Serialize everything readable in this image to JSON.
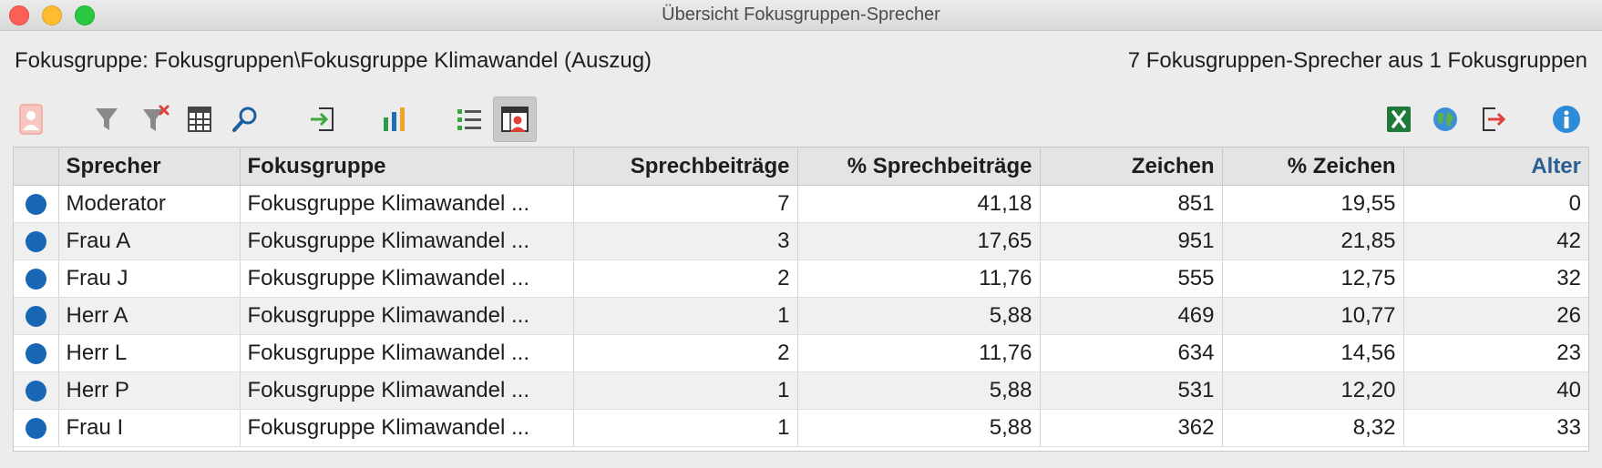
{
  "window": {
    "title": "Übersicht Fokusgruppen-Sprecher"
  },
  "info": {
    "group_label": "Fokusgruppe: Fokusgruppen\\Fokusgruppe Klimawandel (Auszug)",
    "summary": "7 Fokusgruppen-Sprecher aus 1 Fokusgruppen"
  },
  "toolbar": {
    "left_icons": [
      "speaker-card-icon",
      "filter-icon",
      "clear-filter-icon",
      "table-columns-icon",
      "search-icon",
      "export-selection-icon",
      "bar-chart-icon",
      "list-view-icon",
      "speaker-view-icon"
    ],
    "right_icons": [
      "excel-export-icon",
      "html-export-icon",
      "exit-export-icon",
      "info-icon"
    ],
    "active_icon": "speaker-view-icon"
  },
  "colors": {
    "dot": "#1767b4",
    "sorted_header": "#2b5f93",
    "excel_green": "#1f7a3a",
    "info_blue": "#2d8bd8"
  },
  "table": {
    "columns": [
      "",
      "Sprecher",
      "Fokusgruppe",
      "Sprechbeiträge",
      "% Sprechbeiträge",
      "Zeichen",
      "% Zeichen",
      "Alter"
    ],
    "sorted_column": "Alter",
    "rows": [
      {
        "sprecher": "Moderator",
        "fokusgruppe": "Fokusgruppe Klimawandel ...",
        "beitraege": "7",
        "pct_beitraege": "41,18",
        "zeichen": "851",
        "pct_zeichen": "19,55",
        "alter": "0"
      },
      {
        "sprecher": "Frau A",
        "fokusgruppe": "Fokusgruppe Klimawandel ...",
        "beitraege": "3",
        "pct_beitraege": "17,65",
        "zeichen": "951",
        "pct_zeichen": "21,85",
        "alter": "42"
      },
      {
        "sprecher": "Frau J",
        "fokusgruppe": "Fokusgruppe Klimawandel ...",
        "beitraege": "2",
        "pct_beitraege": "11,76",
        "zeichen": "555",
        "pct_zeichen": "12,75",
        "alter": "32"
      },
      {
        "sprecher": "Herr A",
        "fokusgruppe": "Fokusgruppe Klimawandel ...",
        "beitraege": "1",
        "pct_beitraege": "5,88",
        "zeichen": "469",
        "pct_zeichen": "10,77",
        "alter": "26"
      },
      {
        "sprecher": "Herr L",
        "fokusgruppe": "Fokusgruppe Klimawandel ...",
        "beitraege": "2",
        "pct_beitraege": "11,76",
        "zeichen": "634",
        "pct_zeichen": "14,56",
        "alter": "23"
      },
      {
        "sprecher": "Herr P",
        "fokusgruppe": "Fokusgruppe Klimawandel ...",
        "beitraege": "1",
        "pct_beitraege": "5,88",
        "zeichen": "531",
        "pct_zeichen": "12,20",
        "alter": "40"
      },
      {
        "sprecher": "Frau I",
        "fokusgruppe": "Fokusgruppe Klimawandel ...",
        "beitraege": "1",
        "pct_beitraege": "5,88",
        "zeichen": "362",
        "pct_zeichen": "8,32",
        "alter": "33"
      }
    ]
  }
}
